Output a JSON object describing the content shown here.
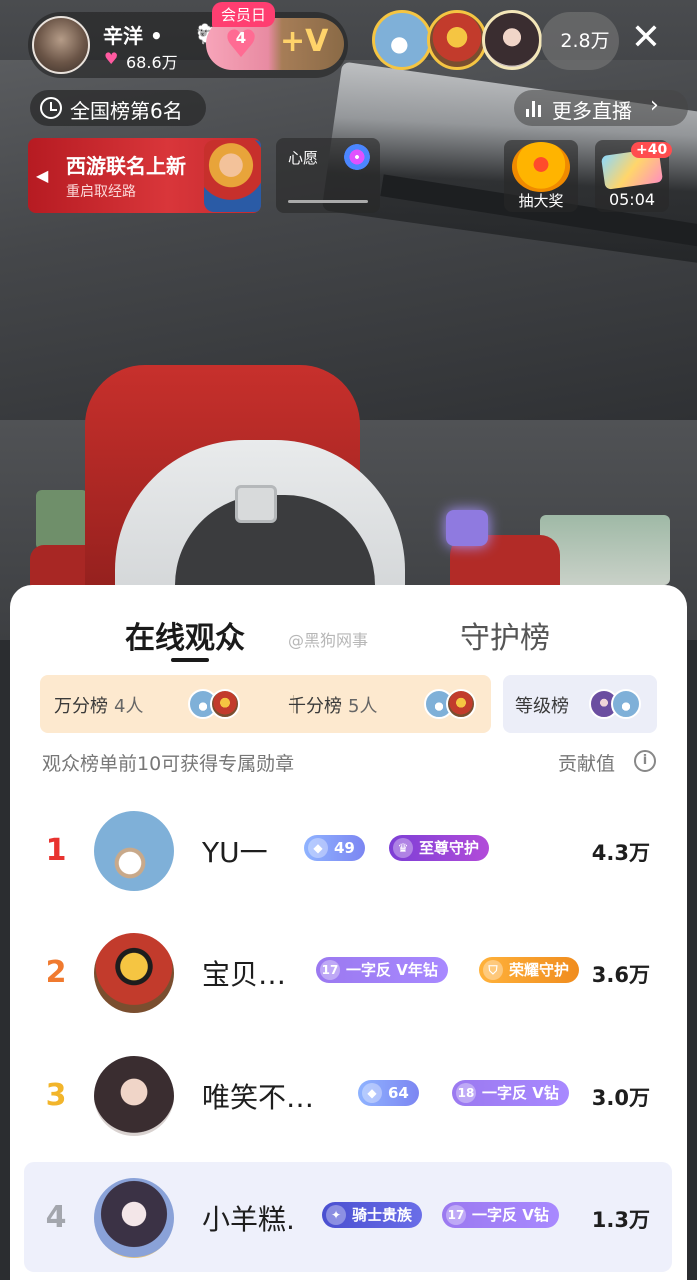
{
  "host": {
    "name": "辛洋 •",
    "sheep_icon": "sheep-icon",
    "fans": "68.6万"
  },
  "member": {
    "tag": "会员日",
    "heart_count": "4",
    "plus_v": "+V"
  },
  "viewer_count": "2.8万",
  "rank_pill": "全国榜第6名",
  "more_live": "更多直播",
  "promo": {
    "title": "西游联名上新",
    "subtitle": "重启取经路"
  },
  "wish": {
    "label": "心愿"
  },
  "lottery": {
    "label": "抽大奖"
  },
  "timer": {
    "bonus": "+40",
    "time": "05:04"
  },
  "sheet": {
    "tabs": [
      "在线观众",
      "守护榜"
    ],
    "active_tab": "在线观众",
    "watermark": "@黑狗网事",
    "rank_switch": {
      "wan": {
        "label": "万分榜",
        "count": "4人"
      },
      "qian": {
        "label": "千分榜",
        "count": "5人"
      },
      "level": {
        "label": "等级榜"
      }
    },
    "hint": "观众榜单前10可获得专属勋章",
    "contrib_label": "贡献值",
    "rows": [
      {
        "rank": "1",
        "rank_color": "#e8332f",
        "name": "YU一",
        "value": "4.3万",
        "badges": [
          {
            "text": "49",
            "style": "b-blue",
            "icon": "diamond-icon"
          },
          {
            "text": "至尊守护",
            "style": "b-magenta",
            "icon": "crown-icon"
          }
        ]
      },
      {
        "rank": "2",
        "rank_color": "#f07a2f",
        "name": "宝贝…",
        "value": "3.6万",
        "badges": [
          {
            "text": "一字反 V年钻",
            "style": "b-purple",
            "icon": "level-17-icon",
            "level": "17"
          },
          {
            "text": "荣耀守护",
            "style": "b-orange",
            "icon": "shield-icon"
          }
        ]
      },
      {
        "rank": "3",
        "rank_color": "#f2b52b",
        "name": "唯笑不…",
        "value": "3.0万",
        "badges": [
          {
            "text": "64",
            "style": "b-blue",
            "icon": "diamond-icon"
          },
          {
            "text": "一字反 V钻",
            "style": "b-purple",
            "icon": "level-18-icon",
            "level": "18"
          }
        ]
      },
      {
        "rank": "4",
        "rank_color": "#a3a6ad",
        "name": "小羊糕.",
        "value": "1.3万",
        "badges": [
          {
            "text": "骑士贵族",
            "style": "b-indigo",
            "icon": "knight-icon"
          },
          {
            "text": "一字反 V钻",
            "style": "b-purple",
            "icon": "level-17-icon",
            "level": "17"
          }
        ]
      }
    ]
  }
}
